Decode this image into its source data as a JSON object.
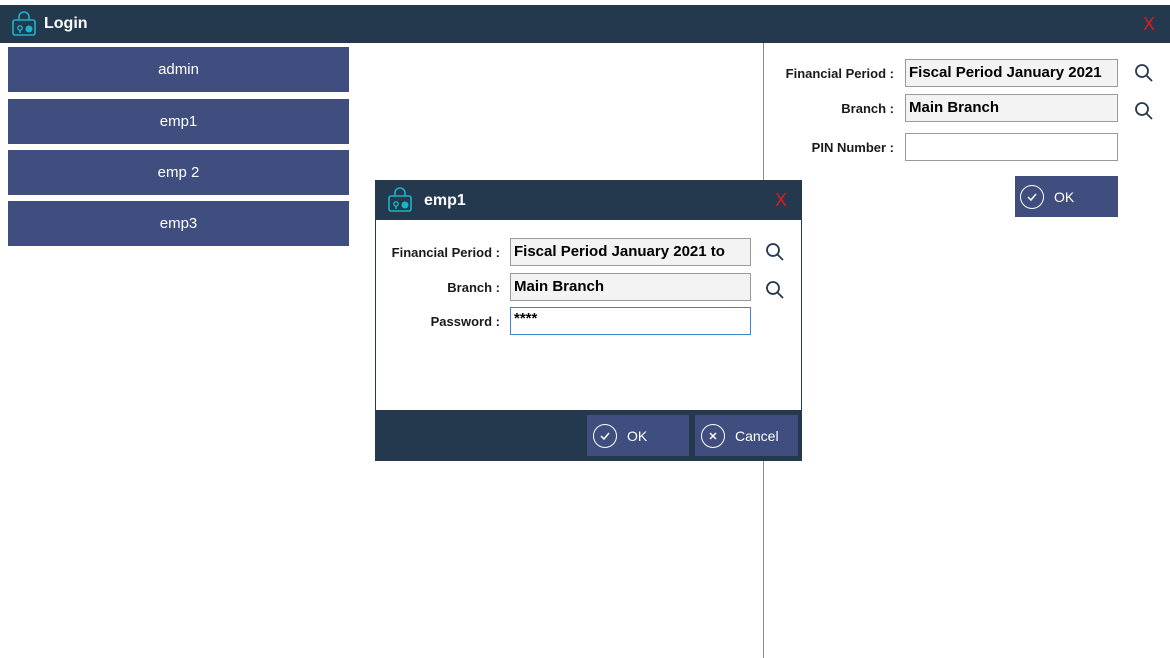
{
  "window": {
    "title": "Login",
    "close_label": "X",
    "icon": "login-icon"
  },
  "users": [
    {
      "label": "admin"
    },
    {
      "label": "emp1"
    },
    {
      "label": "emp 2"
    },
    {
      "label": "emp3"
    }
  ],
  "right_panel": {
    "financial_period_label": "Financial Period :",
    "financial_period_value": "Fiscal Period January 2021",
    "branch_label": "Branch :",
    "branch_value": "Main Branch",
    "pin_label": "PIN Number :",
    "pin_value": "",
    "ok_label": "OK"
  },
  "dialog": {
    "title": "emp1",
    "close_label": "X",
    "financial_period_label": "Financial Period :",
    "financial_period_value": "Fiscal Period January 2021 to",
    "branch_label": "Branch :",
    "branch_value": "Main Branch",
    "password_label": "Password :",
    "password_value": "****",
    "ok_label": "OK",
    "cancel_label": "Cancel"
  },
  "colors": {
    "titlebar": "#24384e",
    "button": "#3f4e7e",
    "close": "#e21b1b",
    "icon_accent": "#19b6c9"
  }
}
